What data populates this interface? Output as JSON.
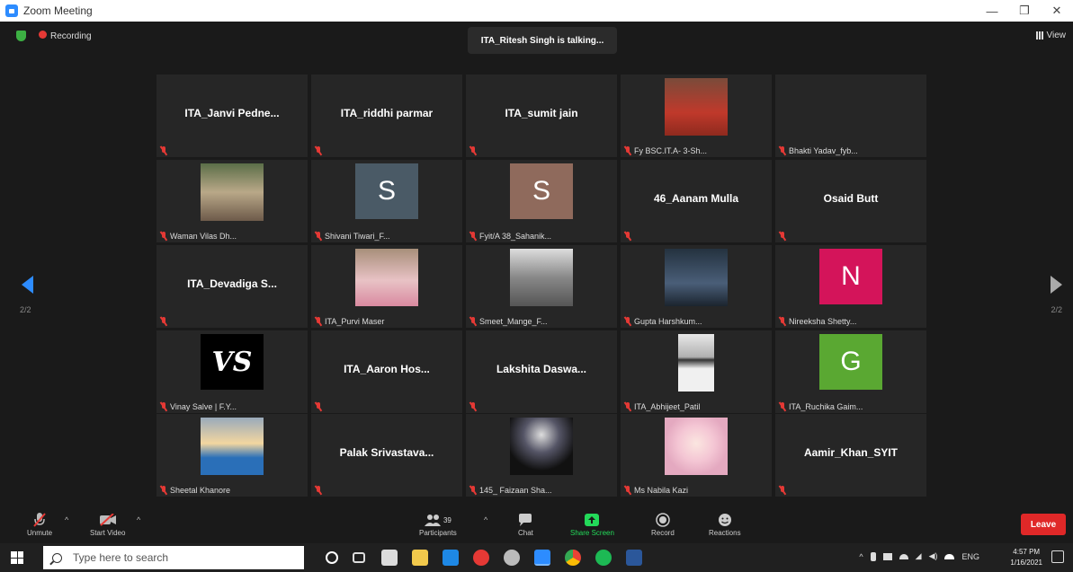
{
  "window": {
    "title": "Zoom Meeting",
    "controls": [
      "—",
      "❐",
      "✕"
    ]
  },
  "meeting": {
    "recording_label": "Recording",
    "talking_text": "ITA_Ritesh Singh is talking...",
    "view_label": "View",
    "page_left": "2/2",
    "page_right": "2/2"
  },
  "tiles": [
    {
      "center": "ITA_Janvi  Pedne...",
      "label": ""
    },
    {
      "center": "ITA_riddhi parmar",
      "label": ""
    },
    {
      "center": "ITA_sumit jain",
      "label": ""
    },
    {
      "center": "",
      "label": "Fy BSC.IT.A- 3-Sh..."
    },
    {
      "center": "",
      "label": "Bhakti Yadav_fyb..."
    },
    {
      "center": "",
      "label": "Waman Vilas Dh..."
    },
    {
      "center": "",
      "label": "Shivani Tiwari_F...",
      "avatar": "S",
      "avatar_color": "#4a5a66"
    },
    {
      "center": "",
      "label": "Fyit/A 38_Sahanik...",
      "avatar": "S",
      "avatar_color": "#8f6a5c"
    },
    {
      "center": "46_Aanam Mulla",
      "label": ""
    },
    {
      "center": "Osaid Butt",
      "label": ""
    },
    {
      "center": "ITA_Devadiga  S...",
      "label": ""
    },
    {
      "center": "",
      "label": "ITA_Purvi Maser"
    },
    {
      "center": "",
      "label": "Smeet_Mange_F..."
    },
    {
      "center": "",
      "label": "Gupta Harshkum..."
    },
    {
      "center": "",
      "label": "Nireeksha Shetty...",
      "avatar": "N",
      "avatar_color": "#d4145a"
    },
    {
      "center": "",
      "label": "Vinay Salve | F.Y...",
      "avatar": "VS",
      "avatar_color": "#000000"
    },
    {
      "center": "ITA_Aaron  Hos...",
      "label": ""
    },
    {
      "center": "Lakshita  Daswa...",
      "label": ""
    },
    {
      "center": "",
      "label": "ITA_Abhijeet_Patil"
    },
    {
      "center": "",
      "label": "ITA_Ruchika Gaim...",
      "avatar": "G",
      "avatar_color": "#5aa832"
    },
    {
      "center": "",
      "label": "Sheetal Khanore"
    },
    {
      "center": "Palak  Srivastava...",
      "label": ""
    },
    {
      "center": "",
      "label": "145_ Faizaan Sha..."
    },
    {
      "center": "",
      "label": "Ms Nabila Kazi"
    },
    {
      "center": "Aamir_Khan_SYIT",
      "label": ""
    }
  ],
  "toolbar": {
    "unmute": "Unmute",
    "start_video": "Start Video",
    "participants": "Participants",
    "participants_count": "39",
    "chat": "Chat",
    "share_screen": "Share Screen",
    "record": "Record",
    "reactions": "Reactions",
    "leave": "Leave"
  },
  "taskbar": {
    "search_placeholder": "Type here to search",
    "lang": "ENG",
    "time": "4:57 PM",
    "date": "1/16/2021"
  },
  "colors": {
    "share_green": "#23d959",
    "leave_red": "#e02828",
    "zoom_blue": "#2d8cff"
  }
}
